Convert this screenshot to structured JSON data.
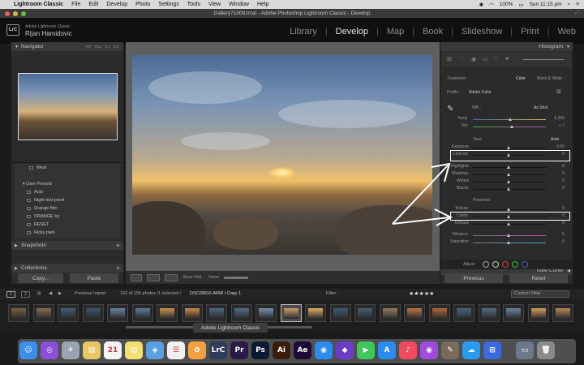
{
  "menubar": {
    "app_name": "Lightroom Classic",
    "items": [
      "File",
      "Edit",
      "Develop",
      "Photo",
      "Settings",
      "Tools",
      "View",
      "Window",
      "Help"
    ],
    "battery": "100%",
    "clock": "Sun 11:15 pm"
  },
  "window": {
    "title": "Gallery71000.lrcat - Adobe Photoshop Lightroom Classic - Develop"
  },
  "identity": {
    "badge": "LrC",
    "subtitle": "Adobe Lightroom Classic",
    "name": "Rijan Hamidovic"
  },
  "modules": [
    "Library",
    "Develop",
    "Map",
    "Book",
    "Slideshow",
    "Print",
    "Web"
  ],
  "active_module": "Develop",
  "left_panel": {
    "navigator": {
      "title": "Navigator",
      "zoom": [
        "FIT",
        "FILL",
        "1:1",
        "1:8"
      ]
    },
    "preset_west": "West",
    "user_presets": {
      "title": "User Presets",
      "items": [
        "Auto",
        "Night test preet",
        "Orange film",
        "ORANGE try",
        "RESET",
        "Ricky park"
      ]
    },
    "snapshots": "Snapshots",
    "collections": "Collections",
    "copy_button": "Copy...",
    "paste_button": "Paste"
  },
  "toolbar": {
    "show_grid_label": "Show Grid :",
    "show_grid_value": "Never"
  },
  "right_panel": {
    "histogram": "Histogram",
    "treatment_label": "Treatment :",
    "treatment_color": "Color",
    "treatment_bw": "Black & White",
    "profile_label": "Profile :",
    "profile_value": "Adobe Color",
    "wb_label": "WB :",
    "wb_value": "As Shot",
    "temp_label": "Temp",
    "temp_value": "5,200",
    "tint_label": "Tint",
    "tint_value": "+ 7",
    "tone_label": "Tone",
    "tone_auto": "Auto",
    "exposure_label": "Exposure",
    "exposure_value": "0.00",
    "contrast_label": "Contrast",
    "contrast_value": "0",
    "highlights_label": "Highlights",
    "highlights_value": "0",
    "shadows_label": "Shadows",
    "shadows_value": "0",
    "whites_label": "Whites",
    "whites_value": "0",
    "blacks_label": "Blacks",
    "blacks_value": "0",
    "presence_label": "Presence",
    "texture_label": "Texture",
    "texture_value": "0",
    "clarity_label": "Clarity",
    "clarity_value": "0",
    "dehaze_label": "Dehaze",
    "dehaze_value": "0",
    "vibrance_label": "Vibrance",
    "vibrance_value": "0",
    "saturation_label": "Saturation",
    "saturation_value": "0",
    "tone_curve": "Tone Curve",
    "adjust_label": "Adjust :",
    "previous_button": "Previous",
    "reset_button": "Reset"
  },
  "filmstrip_bar": {
    "page1": "1",
    "page2": "2",
    "source": "Previous Import",
    "count": "102 of 155 photos /1 selected /",
    "filename": "DSC09516.ARW / Copy 1",
    "filter_label": "Filter :",
    "stars": "★★★★★",
    "custom_filter": "Custom Filter"
  },
  "tooltip": "Adobe Lightroom Classic",
  "dock": [
    "Finder",
    "Siri",
    "Launchpad",
    "Notes",
    "Calendar",
    "Notes",
    "Preview",
    "Reminders",
    "Photos",
    "LrC",
    "Pr",
    "Ps",
    "Ai",
    "Ae",
    "Zoom",
    "VS",
    "FaceTime",
    "App Store",
    "Music",
    "Podcasts",
    "Keychain",
    "Messages",
    "Calendar",
    "Screen",
    "Trash"
  ]
}
